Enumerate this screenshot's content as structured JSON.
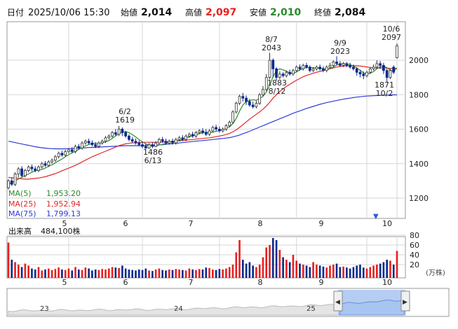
{
  "header": {
    "date_label": "日付",
    "datetime": "2025/10/06 15:30",
    "open_label": "始値",
    "open": "2,014",
    "high_label": "高値",
    "high": "2,097",
    "low_label": "安値",
    "low": "2,010",
    "close_label": "終値",
    "close": "2,084"
  },
  "legend": {
    "ma5_label": "MA(5)",
    "ma5_value": "1,953.20",
    "ma25_label": "MA(25)",
    "ma25_value": "1,952.94",
    "ma75_label": "MA(75)",
    "ma75_value": "1,799.13"
  },
  "volume_header": {
    "label": "出来高",
    "value": "484,100株"
  },
  "volume_unit": "(万株)",
  "colors": {
    "up": "#e62020",
    "down": "#0a2a8c",
    "ma5": "#2a8a2a",
    "ma25": "#e02828",
    "ma75": "#2c3cd8",
    "grid": "#d6d6d6",
    "nav_fill": "#a8c4f0"
  },
  "chart_data": [
    {
      "type": "candlestick",
      "title": "",
      "x_ticks": [
        "5",
        "6",
        "7",
        "8",
        "9",
        "10"
      ],
      "ylim": [
        1100,
        2200
      ],
      "y_ticks": [
        1200,
        1400,
        1600,
        1800,
        2000
      ],
      "grid": true,
      "annotations": [
        {
          "date": "6/2",
          "value": "1619",
          "text": [
            "6/2",
            "1619"
          ]
        },
        {
          "date": "6/13",
          "value": "1486",
          "text": [
            "1486",
            "6/13"
          ]
        },
        {
          "date": "8/7",
          "value": "2043",
          "text": [
            "8/7",
            "2043"
          ]
        },
        {
          "date": "8/12",
          "value": "1883",
          "text": [
            "1883",
            "8/12"
          ]
        },
        {
          "date": "9/9",
          "value": "2023",
          "text": [
            "9/9",
            "2023"
          ]
        },
        {
          "date": "10/2",
          "value": "1871",
          "text": [
            "1871",
            "10/2"
          ]
        },
        {
          "date": "10/6",
          "value": "2097",
          "text": [
            "10/6",
            "2097"
          ]
        }
      ],
      "candles": [
        [
          1260,
          1300,
          1250,
          1310
        ],
        [
          1300,
          1280,
          1270,
          1320
        ],
        [
          1280,
          1340,
          1270,
          1350
        ],
        [
          1340,
          1370,
          1320,
          1380
        ],
        [
          1370,
          1330,
          1320,
          1385
        ],
        [
          1330,
          1360,
          1320,
          1370
        ],
        [
          1360,
          1380,
          1350,
          1390
        ],
        [
          1380,
          1370,
          1355,
          1395
        ],
        [
          1370,
          1360,
          1350,
          1385
        ],
        [
          1360,
          1380,
          1350,
          1390
        ],
        [
          1380,
          1400,
          1370,
          1410
        ],
        [
          1400,
          1390,
          1380,
          1415
        ],
        [
          1390,
          1410,
          1380,
          1420
        ],
        [
          1410,
          1420,
          1400,
          1430
        ],
        [
          1420,
          1440,
          1410,
          1450
        ],
        [
          1440,
          1460,
          1430,
          1470
        ],
        [
          1460,
          1450,
          1440,
          1475
        ],
        [
          1450,
          1470,
          1440,
          1480
        ],
        [
          1470,
          1480,
          1460,
          1490
        ],
        [
          1480,
          1470,
          1460,
          1495
        ],
        [
          1470,
          1500,
          1460,
          1510
        ],
        [
          1500,
          1490,
          1480,
          1515
        ],
        [
          1490,
          1520,
          1480,
          1530
        ],
        [
          1520,
          1530,
          1510,
          1540
        ],
        [
          1530,
          1520,
          1510,
          1545
        ],
        [
          1520,
          1510,
          1500,
          1535
        ],
        [
          1510,
          1500,
          1490,
          1525
        ],
        [
          1500,
          1520,
          1490,
          1530
        ],
        [
          1520,
          1530,
          1510,
          1540
        ],
        [
          1530,
          1550,
          1520,
          1560
        ],
        [
          1550,
          1560,
          1540,
          1570
        ],
        [
          1560,
          1580,
          1550,
          1590
        ],
        [
          1580,
          1570,
          1560,
          1600
        ],
        [
          1570,
          1600,
          1560,
          1619
        ],
        [
          1600,
          1580,
          1560,
          1610
        ],
        [
          1580,
          1560,
          1550,
          1590
        ],
        [
          1560,
          1540,
          1530,
          1570
        ],
        [
          1540,
          1530,
          1520,
          1555
        ],
        [
          1530,
          1520,
          1510,
          1545
        ],
        [
          1520,
          1510,
          1500,
          1535
        ],
        [
          1510,
          1500,
          1490,
          1525
        ],
        [
          1500,
          1490,
          1486,
          1515
        ],
        [
          1490,
          1510,
          1486,
          1520
        ],
        [
          1510,
          1500,
          1490,
          1525
        ],
        [
          1500,
          1520,
          1495,
          1530
        ],
        [
          1520,
          1540,
          1510,
          1550
        ],
        [
          1540,
          1530,
          1520,
          1555
        ],
        [
          1530,
          1520,
          1510,
          1545
        ],
        [
          1520,
          1530,
          1510,
          1540
        ],
        [
          1530,
          1520,
          1510,
          1545
        ],
        [
          1520,
          1540,
          1510,
          1550
        ],
        [
          1540,
          1550,
          1530,
          1560
        ],
        [
          1550,
          1540,
          1530,
          1565
        ],
        [
          1540,
          1560,
          1530,
          1570
        ],
        [
          1560,
          1570,
          1550,
          1580
        ],
        [
          1570,
          1560,
          1550,
          1585
        ],
        [
          1560,
          1580,
          1550,
          1590
        ],
        [
          1580,
          1590,
          1570,
          1600
        ],
        [
          1590,
          1580,
          1570,
          1605
        ],
        [
          1580,
          1570,
          1560,
          1600
        ],
        [
          1570,
          1590,
          1560,
          1600
        ],
        [
          1590,
          1610,
          1580,
          1620
        ],
        [
          1610,
          1600,
          1590,
          1625
        ],
        [
          1600,
          1590,
          1580,
          1615
        ],
        [
          1590,
          1600,
          1580,
          1610
        ],
        [
          1600,
          1620,
          1590,
          1630
        ],
        [
          1620,
          1640,
          1610,
          1650
        ],
        [
          1640,
          1700,
          1630,
          1710
        ],
        [
          1700,
          1750,
          1690,
          1760
        ],
        [
          1750,
          1790,
          1740,
          1800
        ],
        [
          1790,
          1780,
          1760,
          1810
        ],
        [
          1780,
          1760,
          1740,
          1795
        ],
        [
          1760,
          1740,
          1730,
          1775
        ],
        [
          1740,
          1730,
          1720,
          1760
        ],
        [
          1730,
          1750,
          1720,
          1765
        ],
        [
          1750,
          1800,
          1740,
          1810
        ],
        [
          1800,
          1830,
          1790,
          1850
        ],
        [
          1830,
          1900,
          1820,
          1920
        ],
        [
          1900,
          2000,
          1890,
          2043
        ],
        [
          2000,
          1950,
          1900,
          2010
        ],
        [
          1950,
          1900,
          1883,
          1960
        ],
        [
          1900,
          1920,
          1890,
          1935
        ],
        [
          1920,
          1910,
          1900,
          1930
        ],
        [
          1910,
          1930,
          1900,
          1940
        ],
        [
          1930,
          1920,
          1910,
          1945
        ],
        [
          1920,
          1940,
          1910,
          1950
        ],
        [
          1940,
          1960,
          1930,
          1970
        ],
        [
          1960,
          1950,
          1940,
          1975
        ],
        [
          1950,
          1970,
          1940,
          1980
        ],
        [
          1970,
          1960,
          1950,
          1985
        ],
        [
          1960,
          1940,
          1930,
          1970
        ],
        [
          1940,
          1950,
          1930,
          1960
        ],
        [
          1950,
          1960,
          1940,
          1970
        ],
        [
          1960,
          1950,
          1940,
          1975
        ],
        [
          1950,
          1940,
          1930,
          1965
        ],
        [
          1940,
          1960,
          1930,
          1970
        ],
        [
          1960,
          1970,
          1950,
          1985
        ],
        [
          1970,
          1990,
          1960,
          2000
        ],
        [
          1990,
          1980,
          1970,
          2023
        ],
        [
          1980,
          1970,
          1960,
          1995
        ],
        [
          1970,
          1980,
          1960,
          1990
        ],
        [
          1980,
          1970,
          1960,
          1990
        ],
        [
          1970,
          1960,
          1950,
          1985
        ],
        [
          1960,
          1950,
          1940,
          1975
        ],
        [
          1950,
          1930,
          1910,
          1960
        ],
        [
          1930,
          1920,
          1900,
          1945
        ],
        [
          1920,
          1910,
          1890,
          1935
        ],
        [
          1910,
          1930,
          1900,
          1940
        ],
        [
          1930,
          1950,
          1920,
          1960
        ],
        [
          1950,
          1960,
          1940,
          1975
        ],
        [
          1960,
          1980,
          1950,
          2000
        ],
        [
          1980,
          1970,
          1950,
          1995
        ],
        [
          1970,
          1940,
          1920,
          1985
        ],
        [
          1940,
          1900,
          1871,
          1950
        ],
        [
          1900,
          1940,
          1890,
          1950
        ],
        [
          1960,
          1930,
          1920,
          1970
        ],
        [
          2014,
          2084,
          2010,
          2097
        ]
      ],
      "ma5": [
        1280,
        1290,
        1300,
        1310,
        1320,
        1330,
        1340,
        1350,
        1358,
        1362,
        1366,
        1374,
        1385,
        1393,
        1405,
        1416,
        1427,
        1440,
        1452,
        1462,
        1471,
        1483,
        1493,
        1503,
        1511,
        1516,
        1517,
        1518,
        1520,
        1526,
        1534,
        1547,
        1560,
        1573,
        1582,
        1586,
        1580,
        1568,
        1554,
        1540,
        1526,
        1515,
        1508,
        1503,
        1502,
        1508,
        1512,
        1516,
        1524,
        1530,
        1532,
        1534,
        1540,
        1548,
        1556,
        1562,
        1566,
        1574,
        1580,
        1582,
        1580,
        1582,
        1587,
        1592,
        1596,
        1604,
        1614,
        1632,
        1662,
        1704,
        1740,
        1760,
        1766,
        1770,
        1768,
        1778,
        1790,
        1815,
        1855,
        1904,
        1940,
        1950,
        1944,
        1936,
        1926,
        1924,
        1932,
        1944,
        1952,
        1958,
        1958,
        1956,
        1956,
        1954,
        1951,
        1950,
        1952,
        1960,
        1972,
        1978,
        1980,
        1978,
        1975,
        1966,
        1955,
        1942,
        1926,
        1920,
        1924,
        1934,
        1950,
        1962,
        1966,
        1956,
        1942,
        1938,
        1953
      ],
      "ma25": [
        1320,
        1318,
        1316,
        1314,
        1312,
        1310,
        1310,
        1312,
        1314,
        1316,
        1320,
        1324,
        1330,
        1336,
        1342,
        1350,
        1358,
        1366,
        1374,
        1382,
        1390,
        1400,
        1410,
        1420,
        1430,
        1440,
        1448,
        1456,
        1464,
        1472,
        1480,
        1488,
        1496,
        1504,
        1510,
        1515,
        1518,
        1520,
        1521,
        1522,
        1523,
        1524,
        1524,
        1524,
        1524,
        1524,
        1525,
        1526,
        1527,
        1528,
        1530,
        1532,
        1534,
        1536,
        1538,
        1540,
        1542,
        1544,
        1546,
        1548,
        1550,
        1553,
        1556,
        1560,
        1564,
        1569,
        1575,
        1584,
        1596,
        1610,
        1626,
        1642,
        1658,
        1672,
        1686,
        1700,
        1716,
        1734,
        1756,
        1780,
        1800,
        1818,
        1834,
        1848,
        1860,
        1872,
        1884,
        1894,
        1904,
        1912,
        1918,
        1924,
        1930,
        1935,
        1940,
        1945,
        1950,
        1955,
        1960,
        1964,
        1966,
        1967,
        1968,
        1968,
        1968,
        1966,
        1964,
        1961,
        1958,
        1956,
        1955,
        1955,
        1955,
        1954,
        1953,
        1953,
        1953
      ],
      "ma75": [
        1530,
        1526,
        1522,
        1518,
        1514,
        1510,
        1506,
        1502,
        1498,
        1495,
        1492,
        1490,
        1488,
        1487,
        1486,
        1486,
        1486,
        1486,
        1487,
        1488,
        1489,
        1490,
        1491,
        1492,
        1493,
        1494,
        1495,
        1496,
        1497,
        1498,
        1499,
        1500,
        1501,
        1502,
        1503,
        1504,
        1504,
        1504,
        1504,
        1504,
        1504,
        1505,
        1506,
        1507,
        1508,
        1509,
        1510,
        1512,
        1514,
        1516,
        1518,
        1520,
        1522,
        1524,
        1526,
        1528,
        1530,
        1532,
        1534,
        1536,
        1538,
        1540,
        1542,
        1544,
        1546,
        1548,
        1551,
        1555,
        1560,
        1566,
        1573,
        1580,
        1588,
        1596,
        1604,
        1612,
        1620,
        1628,
        1636,
        1644,
        1652,
        1660,
        1668,
        1676,
        1684,
        1692,
        1699,
        1706,
        1713,
        1720,
        1726,
        1732,
        1738,
        1744,
        1749,
        1754,
        1758,
        1762,
        1766,
        1770,
        1774,
        1777,
        1780,
        1783,
        1786,
        1788,
        1790,
        1792,
        1793,
        1794,
        1795,
        1796,
        1797,
        1797,
        1798,
        1799,
        1799
      ]
    },
    {
      "type": "bar",
      "title": "",
      "y_ticks": [
        20,
        40,
        60,
        80
      ],
      "ylim": [
        0,
        90
      ],
      "values": [
        65,
        30,
        25,
        20,
        15,
        22,
        18,
        12,
        10,
        15,
        8,
        10,
        12,
        9,
        11,
        14,
        10,
        9,
        12,
        8,
        15,
        10,
        9,
        14,
        12,
        8,
        10,
        9,
        11,
        10,
        12,
        15,
        14,
        13,
        18,
        12,
        10,
        9,
        8,
        10,
        9,
        12,
        8,
        7,
        10,
        12,
        9,
        8,
        10,
        9,
        11,
        10,
        9,
        8,
        12,
        10,
        9,
        11,
        10,
        14,
        13,
        10,
        9,
        11,
        10,
        12,
        15,
        20,
        45,
        70,
        30,
        22,
        25,
        18,
        15,
        20,
        35,
        55,
        60,
        82,
        70,
        50,
        35,
        30,
        25,
        40,
        28,
        22,
        20,
        18,
        15,
        25,
        20,
        18,
        16,
        14,
        18,
        20,
        22,
        15,
        16,
        14,
        12,
        15,
        18,
        20,
        14,
        12,
        15,
        18,
        20,
        22,
        25,
        30,
        28,
        20,
        48
      ]
    }
  ],
  "navigator": {
    "labels": [
      "23",
      "24",
      "25"
    ],
    "left_handle": "◀",
    "right_handle": "▶"
  }
}
